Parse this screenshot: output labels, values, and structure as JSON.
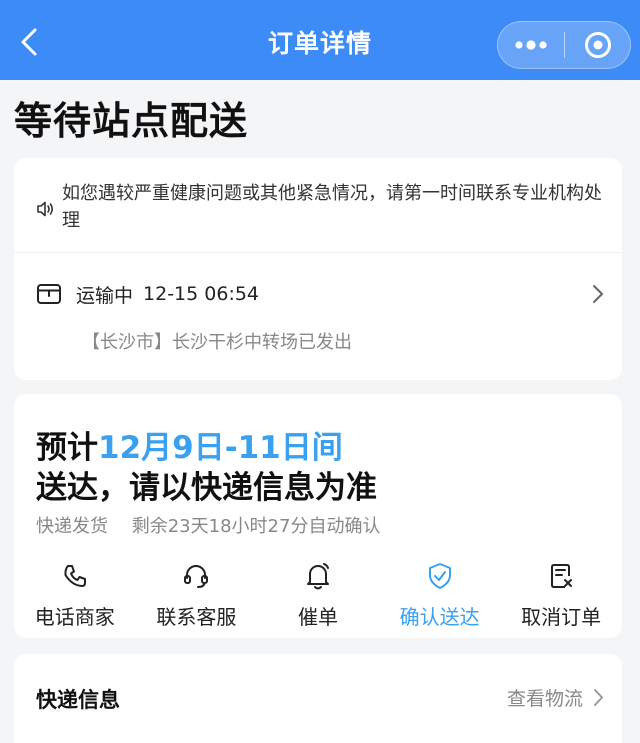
{
  "header": {
    "title": "订单详情",
    "back_icon": "chevron-left-icon",
    "more_icon": "more-dots-icon",
    "close_icon": "target-circle-icon",
    "background": "#3d8bf7"
  },
  "status_title": "等待站点配送",
  "notice": {
    "icon": "speaker-icon",
    "text": "如您遇较严重健康问题或其他紧急情况，请第一时间联系专业机构处理"
  },
  "shipping": {
    "icon": "package-box-icon",
    "status": "运输中",
    "time": "12-15 06:54",
    "detail": "【长沙市】长沙干杉中转场已发出"
  },
  "delivery": {
    "eta_prefix": "预计",
    "eta_range": "12月9日-11日间",
    "eta_suffix": "送达，请以快递信息为准",
    "ship_method": "快递发货",
    "auto_confirm": "剩余23天18小时27分自动确认",
    "accent_color": "#3aa0f0"
  },
  "actions": [
    {
      "label": "电话商家",
      "icon": "phone-icon"
    },
    {
      "label": "联系客服",
      "icon": "headset-icon"
    },
    {
      "label": "催单",
      "icon": "bell-icon"
    },
    {
      "label": "确认送达",
      "icon": "shield-check-icon"
    },
    {
      "label": "取消订单",
      "icon": "cancel-order-icon"
    }
  ],
  "express": {
    "title": "快递信息",
    "link": "查看物流"
  }
}
